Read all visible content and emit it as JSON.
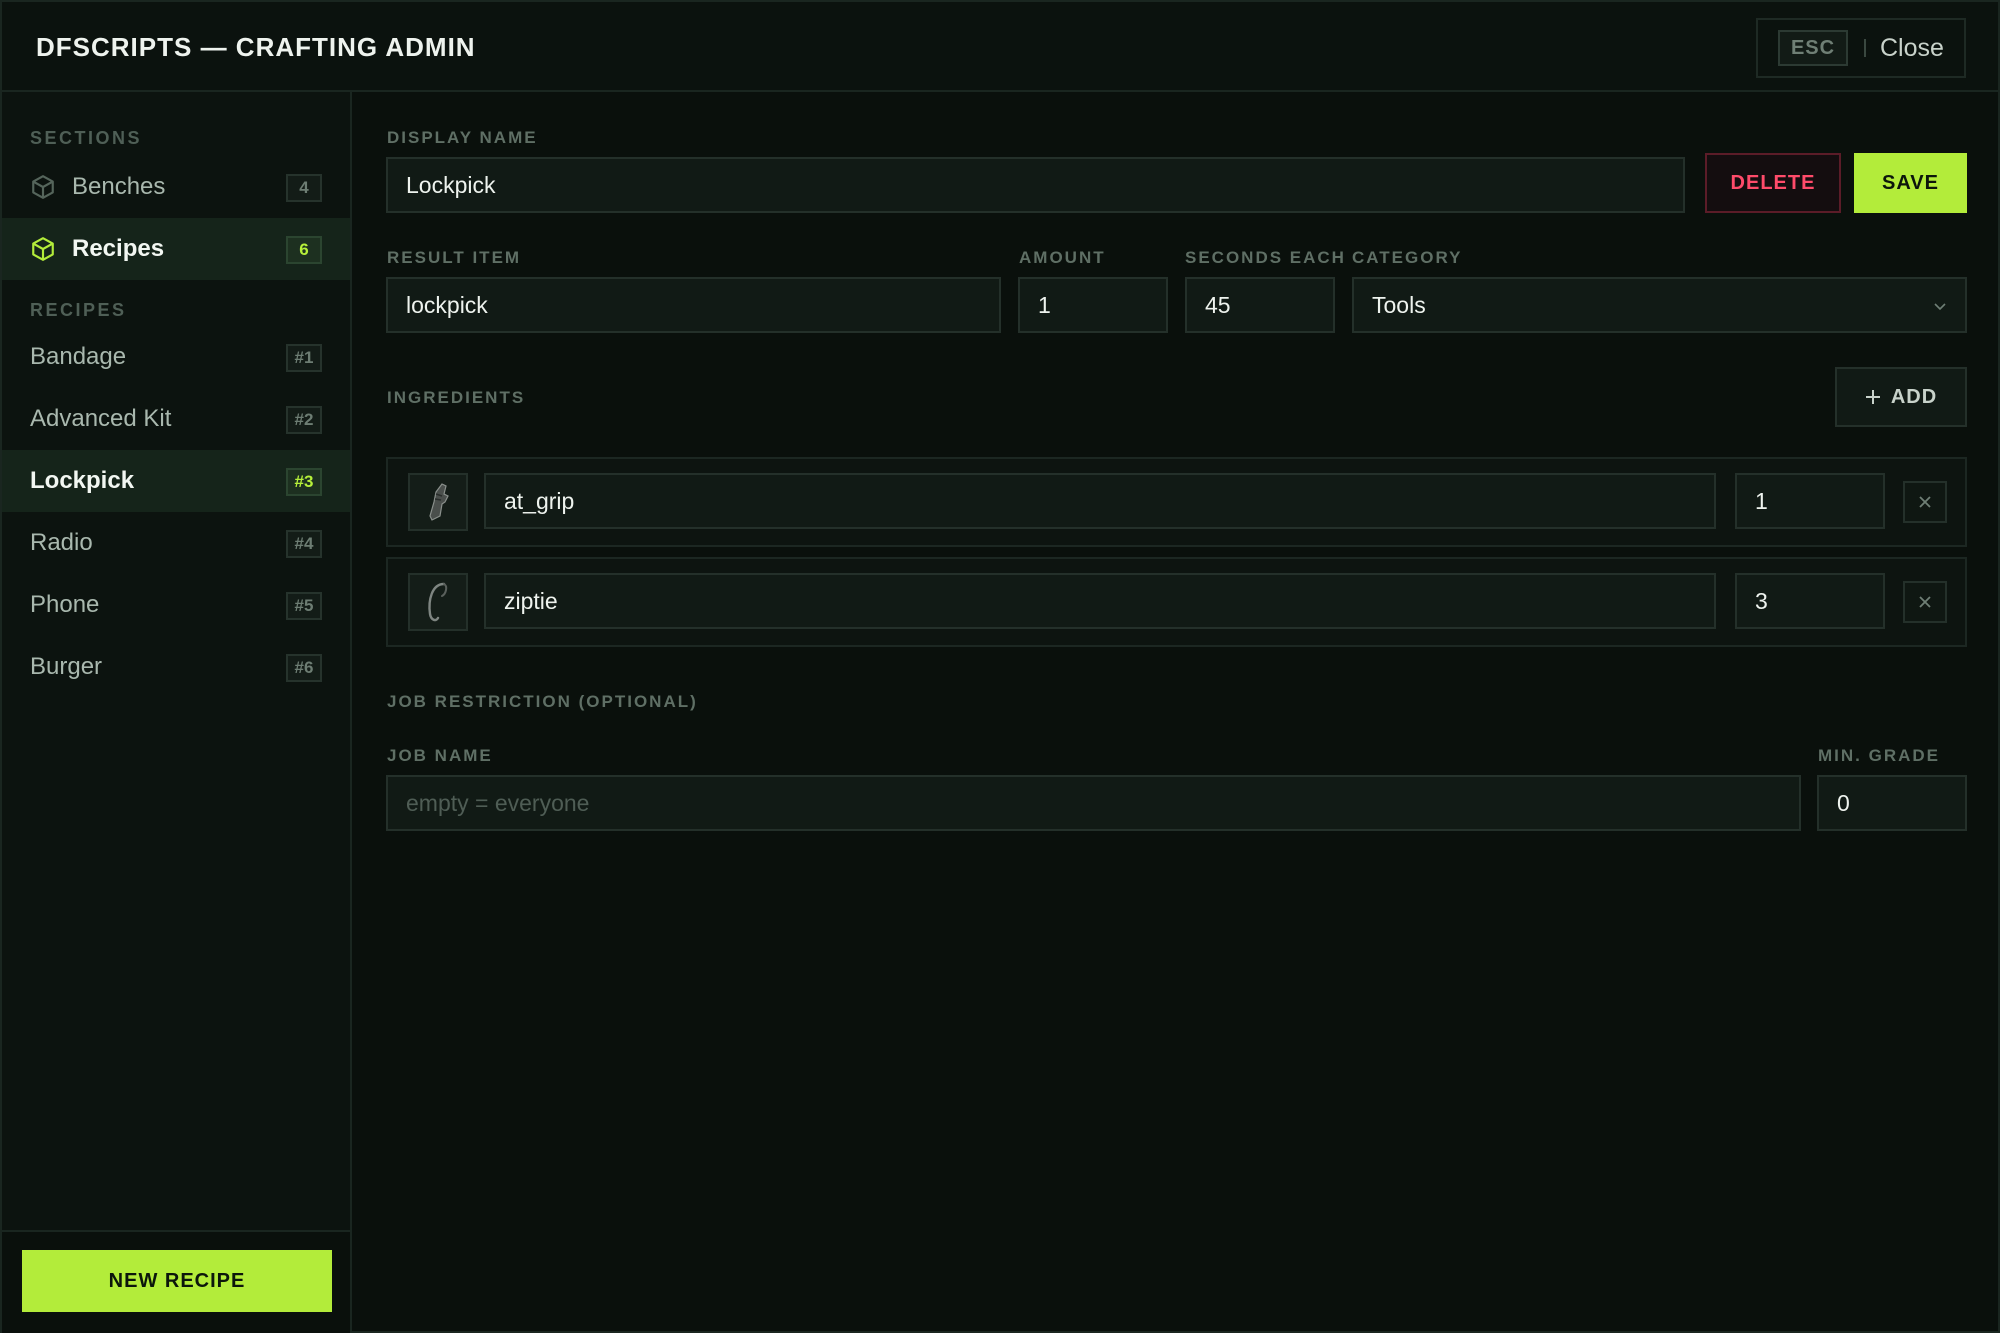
{
  "header": {
    "title": "DFSCRIPTS — CRAFTING ADMIN",
    "esc_key": "ESC",
    "close_label": "Close"
  },
  "sidebar": {
    "sections_heading": "SECTIONS",
    "sections": [
      {
        "label": "Benches",
        "count": "4",
        "icon": "cube-icon",
        "active": false
      },
      {
        "label": "Recipes",
        "count": "6",
        "icon": "cube-icon",
        "active": true
      }
    ],
    "recipes_heading": "RECIPES",
    "recipes": [
      {
        "label": "Bandage",
        "id": "#1"
      },
      {
        "label": "Advanced Kit",
        "id": "#2"
      },
      {
        "label": "Lockpick",
        "id": "#3",
        "active": true
      },
      {
        "label": "Radio",
        "id": "#4"
      },
      {
        "label": "Phone",
        "id": "#5"
      },
      {
        "label": "Burger",
        "id": "#6"
      }
    ],
    "new_recipe_label": "NEW RECIPE"
  },
  "editor": {
    "display_name_label": "DISPLAY NAME",
    "display_name_value": "Lockpick",
    "delete_label": "DELETE",
    "save_label": "SAVE",
    "result_item_label": "RESULT ITEM",
    "result_item_value": "lockpick",
    "amount_label": "AMOUNT",
    "amount_value": "1",
    "seconds_label": "SECONDS EACH",
    "seconds_value": "45",
    "category_label": "CATEGORY",
    "category_value": "Tools",
    "ingredients_label": "INGREDIENTS",
    "add_label": "ADD",
    "ingredients": [
      {
        "item": "at_grip",
        "amount": "1",
        "icon": "grip-icon"
      },
      {
        "item": "ziptie",
        "amount": "3",
        "icon": "ziptie-icon"
      }
    ],
    "job_restriction_label": "JOB RESTRICTION (OPTIONAL)",
    "job_name_label": "JOB NAME",
    "job_name_value": "",
    "job_name_placeholder": "empty = everyone",
    "min_grade_label": "MIN. GRADE",
    "min_grade_value": "0"
  },
  "colors": {
    "accent": "#b3ec3a",
    "danger": "#ff4b6a",
    "background": "#0a100c"
  }
}
